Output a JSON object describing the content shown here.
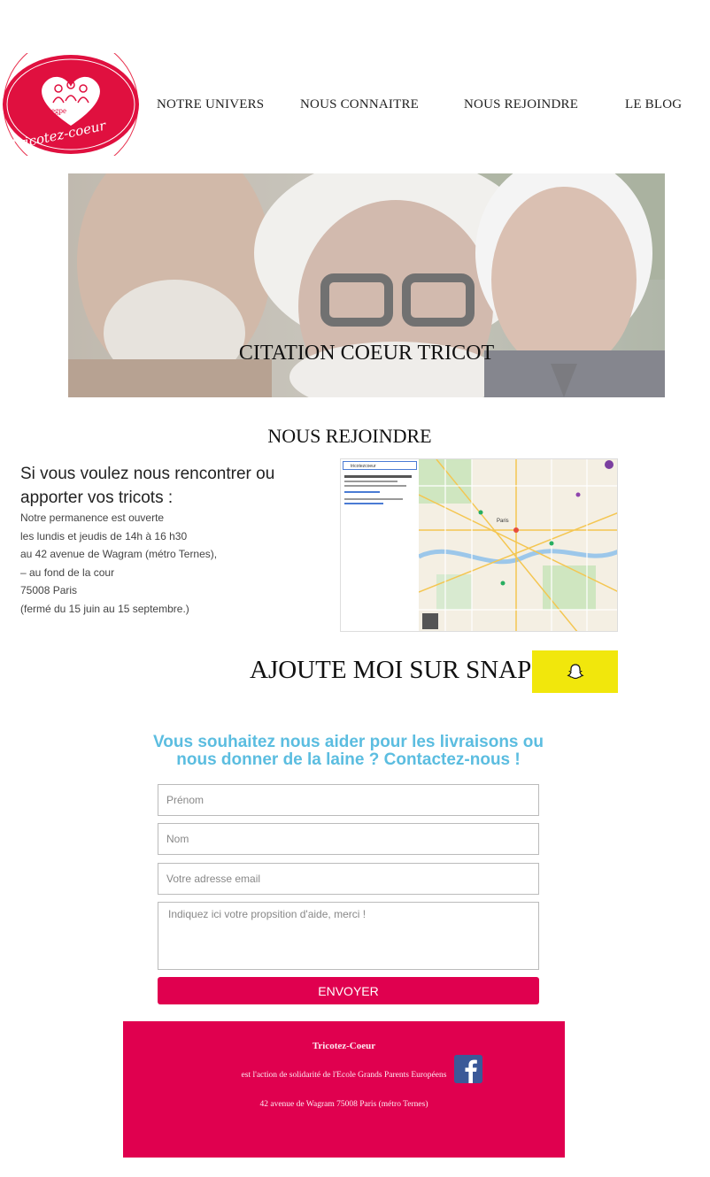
{
  "header": {
    "logo_text": "Tricotez-coeur",
    "logo_badge": "egpe",
    "nav": [
      {
        "label": "NOTRE UNIVERS"
      },
      {
        "label": "NOUS CONNAITRE"
      },
      {
        "label": "NOUS REJOINDRE"
      },
      {
        "label": "LE BLOG"
      }
    ]
  },
  "hero": {
    "title": "CITATION COEUR TRICOT"
  },
  "section_title": "NOUS REJOINDRE",
  "contact_info": {
    "intro": "Si vous voulez nous rencontrer ou apporter vos tricots :",
    "lines": [
      "Notre permanence est ouverte",
      "les lundis et jeudis de 14h à 16 h30",
      "au 42 avenue de Wagram (métro Ternes),",
      "– au fond de la cour",
      "75008 Paris",
      "(fermé du 15 juin au 15 septembre.)"
    ]
  },
  "map": {
    "search_value": "tricotezcoeur",
    "map_label": "Paris"
  },
  "snap": {
    "text": "AJOUTE MOI SUR SNAP",
    "icon": "snapchat-ghost-icon"
  },
  "form": {
    "title": "Vous souhaitez nous aider pour les livraisons ou nous donner de la laine ? Contactez-nous !",
    "first_name_placeholder": "Prénom",
    "last_name_placeholder": "Nom",
    "email_placeholder": "Votre adresse email",
    "message_placeholder": "Indiquez ici votre propsition d'aide, merci !",
    "submit_label": "ENVOYER"
  },
  "footer": {
    "title": "Tricotez-Coeur",
    "line1": "est l'action de solidarité de l'Ecole Grands Parents Européens",
    "line2": "42 avenue de Wagram 75008 Paris (métro Ternes)",
    "social_icon": "facebook-icon"
  },
  "colors": {
    "accent_pink": "#e0004f",
    "form_title_blue": "#5bbde0",
    "snap_yellow": "#f1e70c",
    "facebook_blue": "#3b5998"
  }
}
